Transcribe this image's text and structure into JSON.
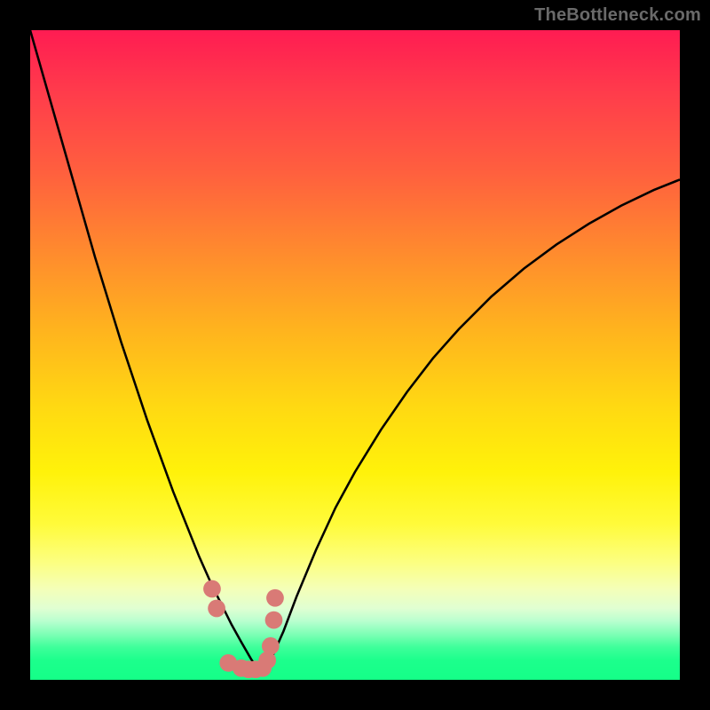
{
  "watermark": "TheBottleneck.com",
  "colors": {
    "black": "#000000",
    "curve": "#000000",
    "marker_fill": "#d97a76",
    "gradient_top": "#ff1c52",
    "gradient_mid": "#fff20a",
    "gradient_bottom": "#15ff88"
  },
  "chart_data": {
    "type": "line",
    "title": "",
    "xlabel": "",
    "ylabel": "",
    "xlim": [
      0,
      100
    ],
    "ylim": [
      0,
      100
    ],
    "grid": false,
    "legend": "none",
    "series": [
      {
        "name": "left-curve",
        "type": "line",
        "x": [
          0,
          2,
          4,
          6,
          8,
          10,
          12,
          14,
          16,
          18,
          20,
          22,
          24,
          26,
          28,
          29.5,
          31,
          32.5,
          34,
          35.5
        ],
        "y": [
          100,
          93,
          86,
          79,
          72,
          65,
          58.5,
          52,
          46,
          40,
          34.5,
          29,
          24,
          19,
          14.5,
          11.5,
          8.5,
          5.8,
          3.2,
          1.0
        ]
      },
      {
        "name": "right-curve",
        "type": "line",
        "x": [
          35.5,
          37,
          39,
          41,
          44,
          47,
          50,
          54,
          58,
          62,
          66,
          71,
          76,
          81,
          86,
          91,
          96,
          100
        ],
        "y": [
          1.0,
          3.0,
          7.5,
          12.8,
          20.0,
          26.5,
          32.0,
          38.5,
          44.3,
          49.5,
          54.0,
          59.0,
          63.3,
          67.0,
          70.2,
          73.0,
          75.4,
          77.0
        ]
      },
      {
        "name": "good-markers",
        "type": "scatter",
        "x": [
          28.0,
          28.7,
          30.5,
          32.5,
          33.6,
          34.7,
          35.8,
          36.5,
          37.0,
          37.5,
          37.7
        ],
        "y": [
          14.0,
          11.0,
          2.6,
          1.8,
          1.6,
          1.6,
          1.8,
          3.0,
          5.2,
          9.2,
          12.6
        ]
      }
    ],
    "annotations": []
  }
}
